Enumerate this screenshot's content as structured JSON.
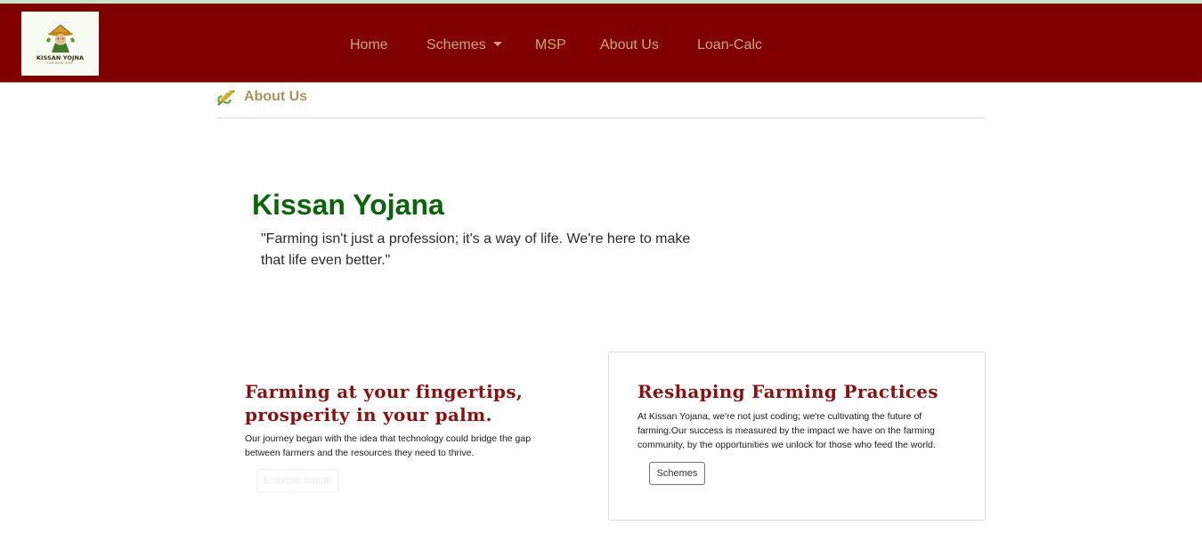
{
  "brand": {
    "logo_text": "KISSAN YOJNA",
    "logo_subtext": "FARMER APP"
  },
  "nav": {
    "home": "Home",
    "schemes": "Schemes",
    "msp": "MSP",
    "about": "About Us",
    "loan": "Loan-Calc"
  },
  "breadcrumb": {
    "icon": "wheat-icon",
    "title": "About Us"
  },
  "hero": {
    "title": "Kissan Yojana",
    "quote": "\"Farming isn't just a profession; it's a way of life. We're here to make that life even better.\""
  },
  "left_section": {
    "title": "Farming at your fingertips, prosperity in your palm.",
    "text": "Our journey began with the idea that technology could bridge the gap between farmers and the resources they need to thrive.",
    "button_label": "Example button"
  },
  "card": {
    "title": "Reshaping Farming Practices",
    "text": "At Kissan Yojana, we're not just coding; we're cultivating the future of farming.Our success is measured by the impact we have on the farming community, by the opportunities we unlock for those who feed the world.",
    "button_label": "Schemes"
  },
  "colors": {
    "navbar": "#800000",
    "nav_text": "#c9a96a",
    "hero_title": "#0a640a",
    "section_title": "#8b1010"
  }
}
